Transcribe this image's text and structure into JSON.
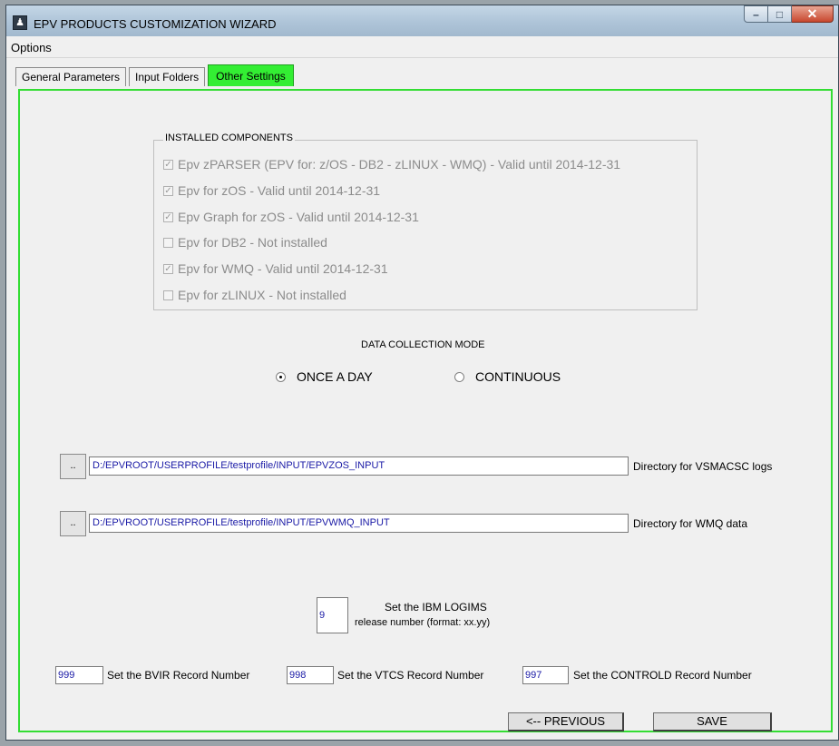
{
  "window": {
    "title": "EPV PRODUCTS CUSTOMIZATION WIZARD",
    "controls": {
      "minimize": "–",
      "maximize": "□",
      "close": "✕"
    }
  },
  "menu": {
    "options": "Options"
  },
  "tabs": [
    {
      "label": "General Parameters"
    },
    {
      "label": "Input Folders"
    },
    {
      "label": "Other Settings"
    }
  ],
  "installed": {
    "title": "INSTALLED COMPONENTS",
    "items": [
      {
        "label": "Epv zPARSER (EPV for: z/OS - DB2 - zLINUX - WMQ) - Valid until 2014-12-31",
        "checked": true
      },
      {
        "label": "Epv for zOS - Valid until 2014-12-31",
        "checked": true
      },
      {
        "label": "Epv Graph for zOS - Valid until 2014-12-31",
        "checked": true
      },
      {
        "label": "Epv for DB2 - Not installed",
        "checked": false
      },
      {
        "label": "Epv for WMQ - Valid until 2014-12-31",
        "checked": true
      },
      {
        "label": "Epv for zLINUX - Not installed",
        "checked": false
      }
    ]
  },
  "collection": {
    "title": "DATA COLLECTION MODE",
    "once_label": "ONCE A DAY",
    "continuous_label": "CONTINUOUS",
    "selected": "ONCE A DAY"
  },
  "dirs": {
    "browse_label": "..",
    "vsmacsc_path": "D:/EPVROOT/USERPROFILE/testprofile/INPUT/EPVZOS_INPUT",
    "vsmacsc_label": "Directory for VSMACSC logs",
    "wmq_path": "D:/EPVROOT/USERPROFILE/testprofile/INPUT/EPVWMQ_INPUT",
    "wmq_label": "Directory for WMQ data"
  },
  "logims": {
    "value": "9",
    "label_line1": "Set the IBM LOGIMS",
    "label_line2": "release number (format: xx.yy)"
  },
  "records": {
    "bvir_value": "999",
    "bvir_label": "Set the BVIR Record Number",
    "vtcs_value": "998",
    "vtcs_label": "Set the VTCS Record Number",
    "controld_value": "997",
    "controld_label": "Set the CONTROLD Record Number"
  },
  "buttons": {
    "previous": "<-- PREVIOUS",
    "save": "SAVE"
  }
}
